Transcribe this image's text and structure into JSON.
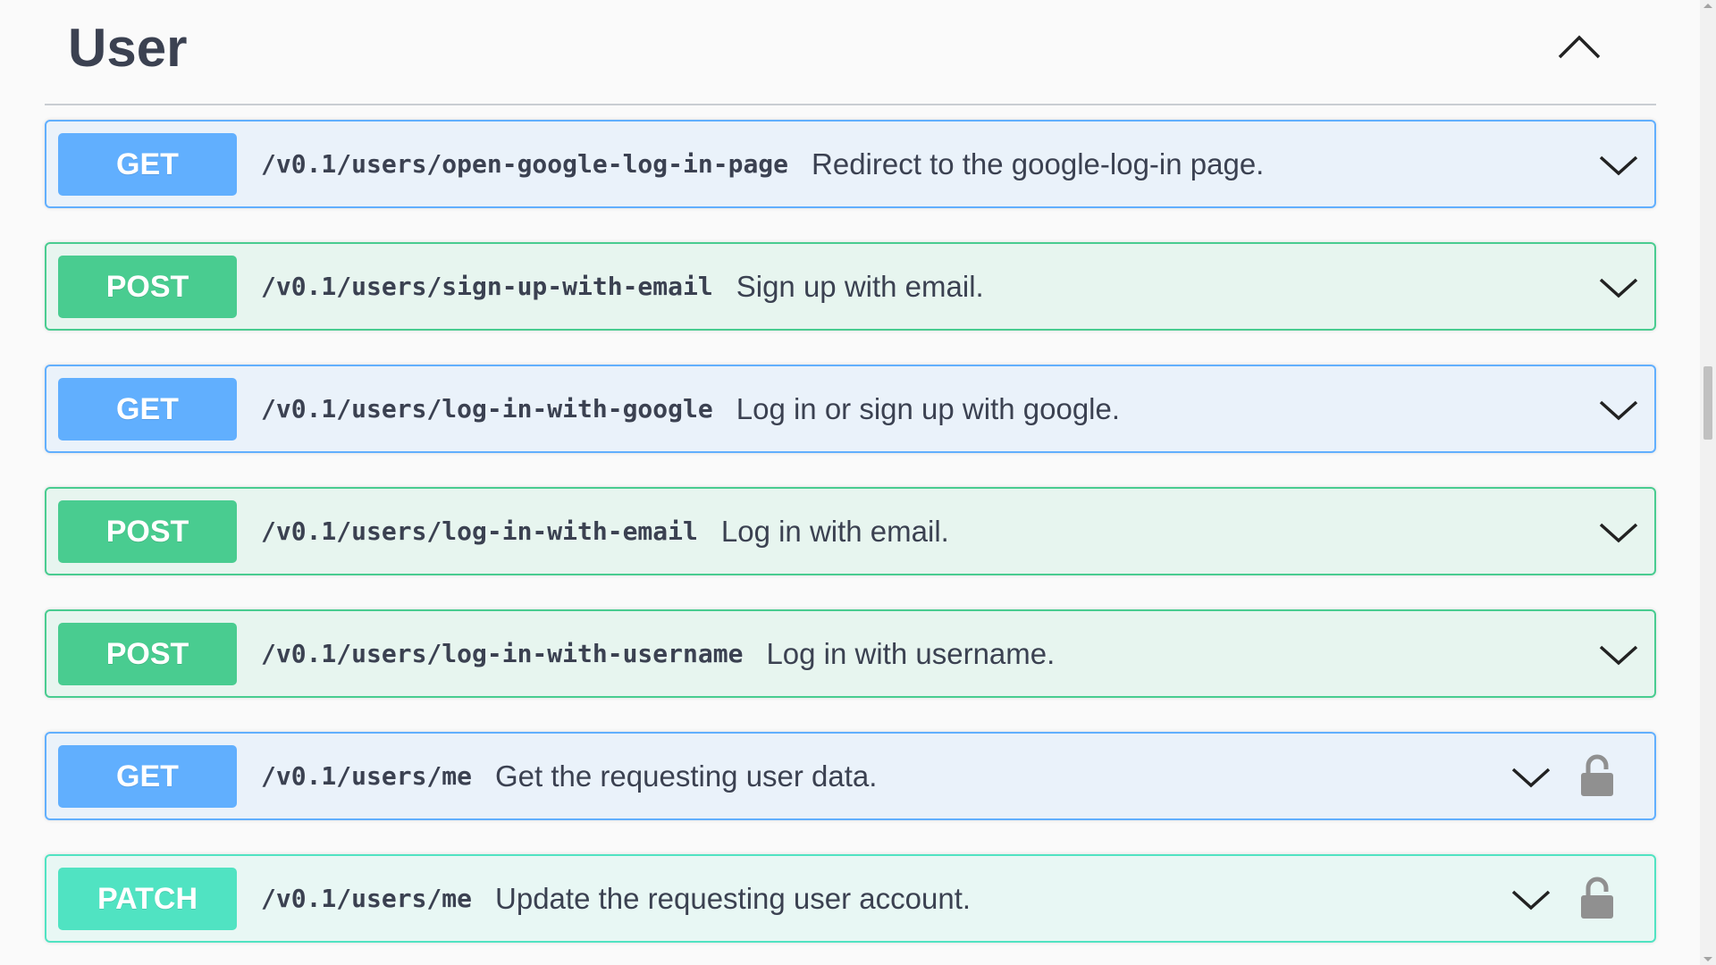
{
  "section": {
    "title": "User",
    "collapse_icon": "chevron-up-icon"
  },
  "operations": [
    {
      "method": "GET",
      "path": "/v0.1/users/open-google-log-in-page",
      "summary": "Redirect to the google-log-in page.",
      "locked": false
    },
    {
      "method": "POST",
      "path": "/v0.1/users/sign-up-with-email",
      "summary": "Sign up with email.",
      "locked": false
    },
    {
      "method": "GET",
      "path": "/v0.1/users/log-in-with-google",
      "summary": "Log in or sign up with google.",
      "locked": false
    },
    {
      "method": "POST",
      "path": "/v0.1/users/log-in-with-email",
      "summary": "Log in with email.",
      "locked": false
    },
    {
      "method": "POST",
      "path": "/v0.1/users/log-in-with-username",
      "summary": "Log in with username.",
      "locked": false
    },
    {
      "method": "GET",
      "path": "/v0.1/users/me",
      "summary": "Get the requesting user data.",
      "locked": true
    },
    {
      "method": "PATCH",
      "path": "/v0.1/users/me",
      "summary": "Update the requesting user account.",
      "locked": true
    }
  ],
  "icons": {
    "expand": "chevron-down-icon",
    "lock": "lock-icon"
  },
  "colors": {
    "get": "#61affe",
    "post": "#49cc90",
    "patch": "#50e3c2",
    "text": "#3b4151"
  }
}
